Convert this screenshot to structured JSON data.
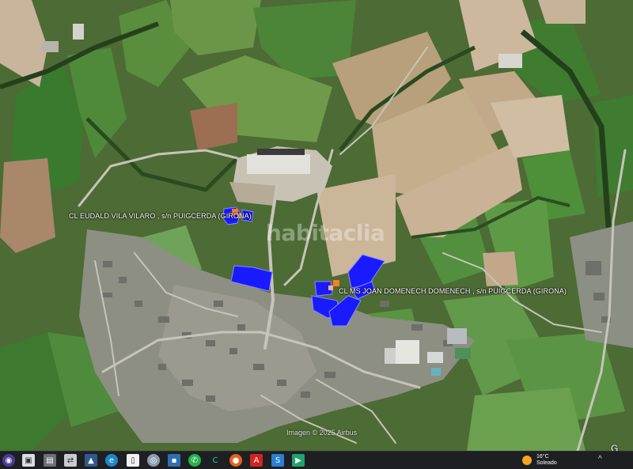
{
  "map": {
    "watermark": "habitaclia",
    "credit": "Imagen © 2025 Airbus",
    "corner_text": "G",
    "labels": {
      "addr1": "CL EUDALD VILA VILARO , s/n PUIGCERDA (GIRONA)",
      "addr2": "CL MS JOAN DOMENECH DOMENECH , s/n PUIGCERDA (GIRONA)"
    },
    "colors": {
      "parcel": "#1a1aff",
      "marker": "#ff7a2a"
    }
  },
  "taskbar": {
    "icons": [
      "start-icon",
      "file-explorer-icon",
      "image-viewer-icon",
      "network-icon",
      "photos-icon",
      "edge-icon",
      "document-icon",
      "chrome-icon",
      "save-icon",
      "whatsapp-icon",
      "app-icon",
      "firefox-icon",
      "acrobat-icon",
      "app2-icon",
      "app3-icon"
    ],
    "weather": {
      "temp": "16°C",
      "condition": "Soleado"
    },
    "tray_chevron": "^"
  }
}
